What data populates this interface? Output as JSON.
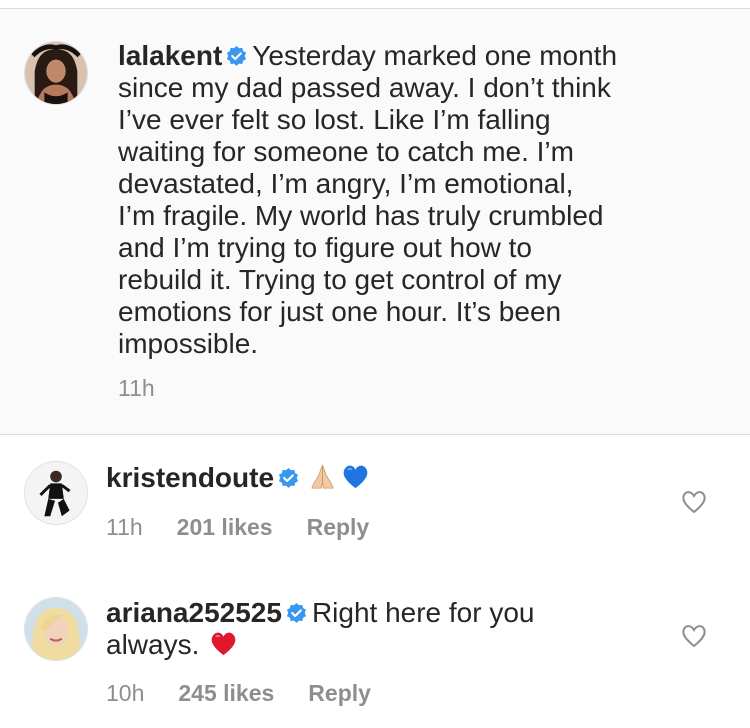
{
  "caption": {
    "username": "lalakent",
    "lines": [
      "Yesterday marked one month",
      "since my dad passed away. I don’t think",
      "I’ve ever felt so lost. Like I’m falling",
      "waiting for someone to catch me. I’m",
      "devastated, I’m angry, I’m emotional,",
      "I’m fragile. My world has truly crumbled",
      "and I’m trying to figure out how to",
      "rebuild it. Trying to get control of my",
      "emotions for just one hour. It’s been",
      "impossible."
    ],
    "time": "11h"
  },
  "comments": [
    {
      "username": "kristendoute",
      "emojis": [
        "folded-hands-emoji",
        "blue-heart-emoji"
      ],
      "time": "11h",
      "likes": "201 likes",
      "reply": "Reply"
    },
    {
      "username": "ariana252525",
      "text_line1": "Right here for you",
      "text_line2": "always.",
      "emojis": [
        "red-heart-emoji"
      ],
      "time": "10h",
      "likes": "245 likes",
      "reply": "Reply"
    }
  ],
  "colors": {
    "verified_blue": "#3897f0",
    "meta_gray": "#8e8e8e",
    "text": "#262626"
  }
}
